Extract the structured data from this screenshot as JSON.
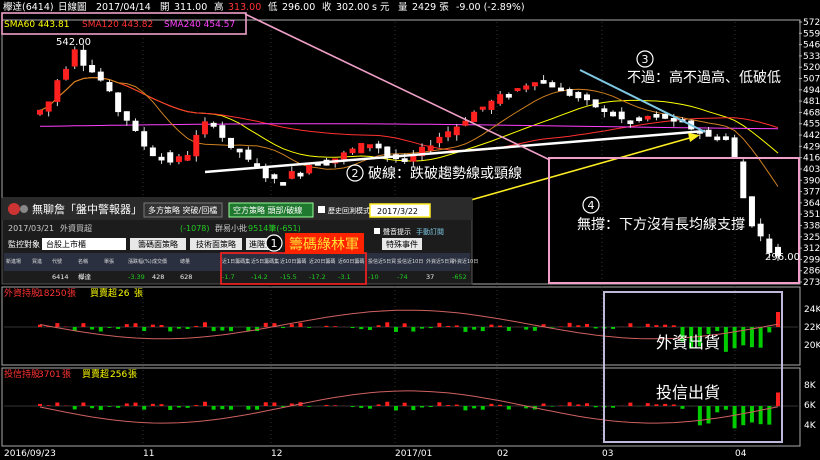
{
  "header": {
    "stock": "欅達(6414)",
    "period": "日線圖",
    "date": "2017/04/14",
    "open_label": "開",
    "open": "311.00",
    "high_label": "高",
    "high": "313.00",
    "low_label": "低",
    "low": "296.00",
    "close_label": "收",
    "close": "302.00",
    "currency": "s 元",
    "vol_label": "量",
    "volume": "2429 張",
    "change": "-9.00 (-2.89%)"
  },
  "sma": [
    {
      "label": "SMA60 443.81",
      "color": "#ffff00"
    },
    {
      "label": "SMA120 443.82",
      "color": "#ff3030"
    },
    {
      "label": "SMA240 454.57",
      "color": "#ff40ff"
    }
  ],
  "price_labels": {
    "peak": "542.00",
    "last": "296.00"
  },
  "price_axis": [
    "572",
    "559",
    "546",
    "533",
    "520",
    "507",
    "494",
    "481",
    "468",
    "455",
    "442",
    "429",
    "416",
    "403",
    "390",
    "377",
    "364",
    "351",
    "338",
    "325",
    "312",
    "299",
    "286",
    "273"
  ],
  "annotations": {
    "a1_num": "1",
    "a1_text": "籌碼綠林軍",
    "a2_num": "2",
    "a2_text": "破線：跌破趨勢線或頸線",
    "a3_num": "3",
    "a3_text": "不過：高不過高、低破低",
    "a4_num": "4",
    "a4_text": "無撐：下方沒有長均線支撐",
    "foreign_out": "外資出貨",
    "trust_out": "投信出貨"
  },
  "screener": {
    "title": "無聊詹「盤中警報器」",
    "tabs": [
      "多方策略 突破/回檔",
      "空方策略 頭部/破線"
    ],
    "history_label": "歷史回測模式",
    "date_value": "2017/3/22",
    "date_info": "2017/03/21",
    "stats": [
      "外資買超",
      "(-1078)",
      "群易小批",
      "9514筆(-651)"
    ],
    "monitor_label": "監控對象",
    "monitor_value": "台股上市櫃",
    "btn1": "籌碼面策略",
    "btn2": "技術面策略",
    "btn3": "進階策略",
    "alert_label": "聲音提示",
    "manual": "手動訂閱",
    "special": "特殊事件",
    "columns": [
      "新進場",
      "買進",
      "代號",
      "名稱",
      "單張",
      "漲跌幅(%)",
      "成交價",
      "總量",
      "近1日籌碼集中度",
      "近5日籌碼集中度",
      "近10日籌碼集中度",
      "近20日籌碼集中度",
      "近60日籌碼集中度",
      "投信近5日買賣超",
      "投信近10日買賣超",
      "外資近5日買賣超",
      "外資近10日買賣超"
    ],
    "row": [
      "",
      "",
      "6414",
      "欅達",
      "",
      "-3.39",
      "428",
      "628",
      "-1.7",
      "-14.2",
      "-15.5",
      "-17.2",
      "-3.1",
      "-10",
      "-74",
      "37",
      "-652"
    ]
  },
  "foreign_panel": {
    "label": "外資持股",
    "value": "18250",
    "unit": "張",
    "bs_label": "買賣超",
    "bs_value": "26",
    "axis": [
      "24K",
      "22K",
      "20K"
    ]
  },
  "trust_panel": {
    "label": "投信持股",
    "value": "3701",
    "unit": "張",
    "bs_label": "買賣超",
    "bs_value": "256",
    "axis": [
      "8K",
      "6K",
      "4K"
    ]
  },
  "x_axis": [
    "2016/09/23",
    "11",
    "12",
    "2017/01",
    "02",
    "03",
    "04"
  ],
  "colors": {
    "up": "#ff3333",
    "down": "#00cc00",
    "cyan": "#00ffff",
    "trend": "#ffffff",
    "lower_high": "#7ec8e3",
    "arrow": "#ffee22",
    "pink": "#f0a0c8"
  },
  "chart_data": {
    "type": "candlestick",
    "title": "欅達(6414) 日線圖",
    "ylim": [
      273,
      572
    ],
    "close_path": [
      470,
      480,
      505,
      520,
      542,
      525,
      515,
      505,
      490,
      470,
      460,
      445,
      430,
      420,
      418,
      412,
      415,
      420,
      440,
      455,
      455,
      440,
      425,
      425,
      412,
      408,
      395,
      390,
      392,
      398,
      402,
      408,
      412,
      410,
      415,
      420,
      425,
      430,
      432,
      428,
      418,
      415,
      412,
      418,
      425,
      432,
      440,
      446,
      452,
      460,
      468,
      474,
      480,
      486,
      490,
      495,
      500,
      505,
      503,
      499,
      494,
      489,
      485,
      480,
      475,
      470,
      465,
      460,
      458,
      460,
      463,
      465,
      462,
      460,
      455,
      450,
      445,
      440,
      442,
      438,
      415,
      370,
      340,
      325,
      310,
      302
    ],
    "foreign_holdings_range": [
      18000,
      24500
    ],
    "trust_holdings_range": [
      3500,
      8500
    ]
  }
}
